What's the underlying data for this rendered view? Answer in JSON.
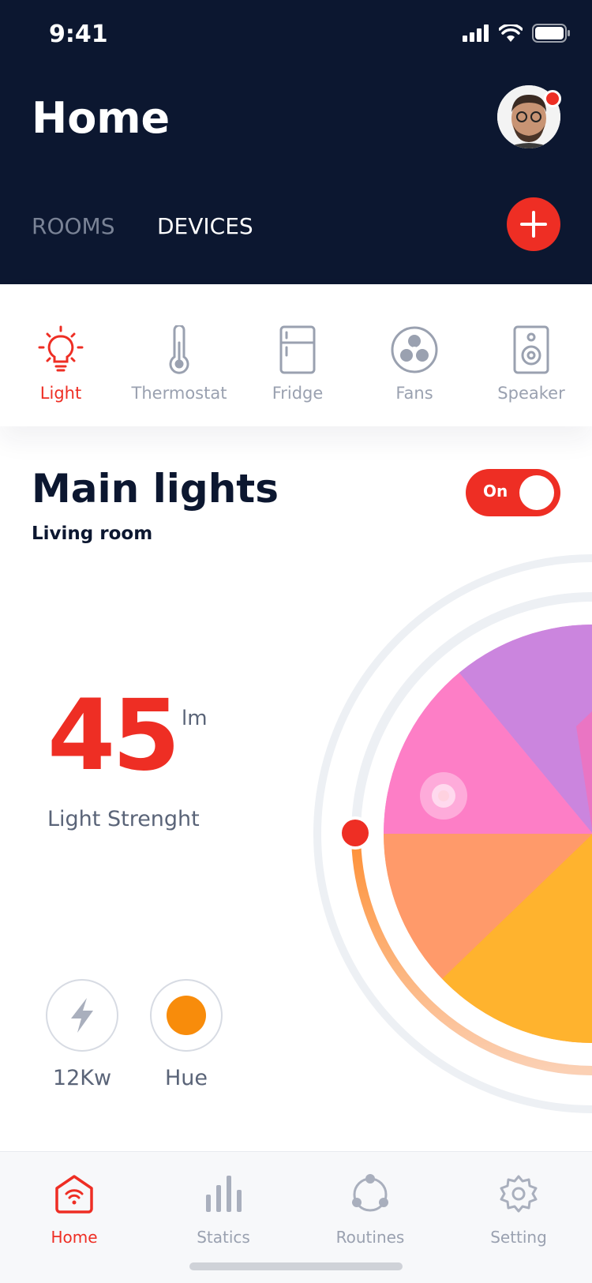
{
  "status": {
    "time": "9:41"
  },
  "header": {
    "title": "Home",
    "tabs": {
      "rooms": "ROOMS",
      "devices": "DEVICES"
    }
  },
  "devices": [
    {
      "label": "Light",
      "icon": "bulb-icon",
      "active": true
    },
    {
      "label": "Thermostat",
      "icon": "thermometer-icon",
      "active": false
    },
    {
      "label": "Fridge",
      "icon": "fridge-icon",
      "active": false
    },
    {
      "label": "Fans",
      "icon": "fan-icon",
      "active": false
    },
    {
      "label": "Speaker",
      "icon": "speaker-icon",
      "active": false
    }
  ],
  "device_card": {
    "title": "Main lights",
    "subtitle": "Living room",
    "toggle_label": "On",
    "value": "45",
    "unit": "lm",
    "value_label": "Light Strenght"
  },
  "stats": [
    {
      "label": "12Kw",
      "icon": "lightning-icon"
    },
    {
      "label": "Hue",
      "icon": "hue-swatch"
    }
  ],
  "nav": [
    {
      "label": "Home",
      "icon": "home-icon",
      "active": true
    },
    {
      "label": "Statics",
      "icon": "bar-chart-icon",
      "active": false
    },
    {
      "label": "Routines",
      "icon": "routines-icon",
      "active": false
    },
    {
      "label": "Setting",
      "icon": "gear-icon",
      "active": false
    }
  ],
  "colors": {
    "accent": "#ee2e24",
    "navy": "#0c1730",
    "muted": "#9aa1b0",
    "hue": "#f88c0b"
  }
}
